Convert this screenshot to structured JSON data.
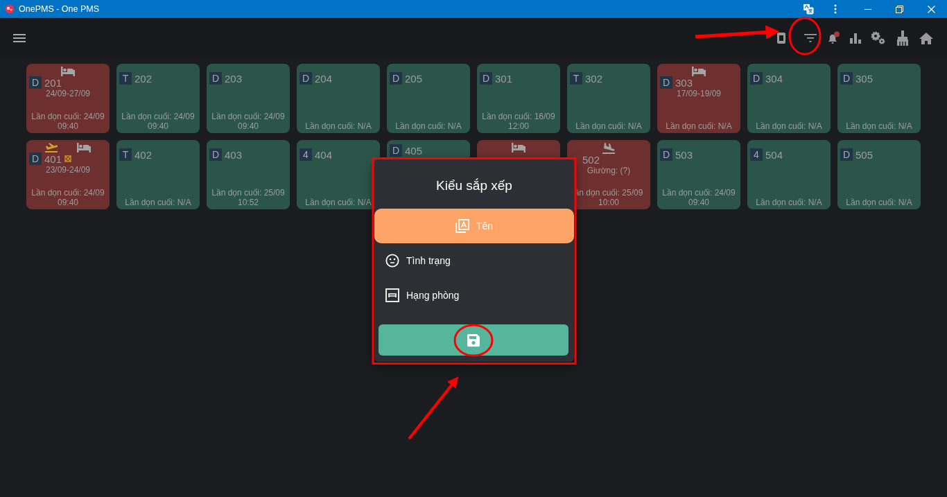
{
  "window": {
    "title": "OnePMS - One PMS"
  },
  "rooms": [
    {
      "badge": "D",
      "number": "201",
      "occupied": true,
      "bed": true,
      "departure": false,
      "arrival": false,
      "flagged": false,
      "dates": "24/09-27/09",
      "cleaning": [
        "Lần dọn cuối: 24/09",
        "09:40"
      ]
    },
    {
      "badge": "T",
      "number": "202",
      "occupied": false,
      "bed": false,
      "departure": false,
      "arrival": false,
      "flagged": false,
      "cleaning": [
        "Lần dọn cuối: 24/09",
        "09:40"
      ]
    },
    {
      "badge": "D",
      "number": "203",
      "occupied": false,
      "bed": false,
      "departure": false,
      "arrival": false,
      "flagged": false,
      "cleaning": [
        "Lần dọn cuối: 24/09",
        "09:40"
      ]
    },
    {
      "badge": "D",
      "number": "204",
      "occupied": false,
      "bed": false,
      "departure": false,
      "arrival": false,
      "flagged": false,
      "cleaning": [
        "Lần dọn cuối: N/A"
      ]
    },
    {
      "badge": "D",
      "number": "205",
      "occupied": false,
      "bed": false,
      "departure": false,
      "arrival": false,
      "flagged": false,
      "cleaning": [
        "Lần dọn cuối: N/A"
      ]
    },
    {
      "badge": "D",
      "number": "301",
      "occupied": false,
      "bed": false,
      "departure": false,
      "arrival": false,
      "flagged": false,
      "cleaning": [
        "Lần dọn cuối: 16/09",
        "12:00"
      ]
    },
    {
      "badge": "T",
      "number": "302",
      "occupied": false,
      "bed": false,
      "departure": false,
      "arrival": false,
      "flagged": false,
      "cleaning": [
        "Lần dọn cuối: N/A"
      ]
    },
    {
      "badge": "D",
      "number": "303",
      "occupied": true,
      "bed": true,
      "departure": false,
      "arrival": false,
      "flagged": false,
      "dates": "17/09-19/09",
      "cleaning": [
        "Lần dọn cuối: N/A"
      ]
    },
    {
      "badge": "D",
      "number": "304",
      "occupied": false,
      "bed": false,
      "departure": false,
      "arrival": false,
      "flagged": false,
      "cleaning": [
        "Lần dọn cuối: N/A"
      ]
    },
    {
      "badge": "D",
      "number": "305",
      "occupied": false,
      "bed": false,
      "departure": false,
      "arrival": false,
      "flagged": false,
      "cleaning": [
        "Lần dọn cuối: N/A"
      ]
    },
    {
      "badge": "D",
      "number": "401",
      "occupied": true,
      "bed": true,
      "departure": true,
      "arrival": false,
      "flagged": true,
      "dates": "23/09-24/09",
      "cleaning": [
        "Lần dọn cuối: 24/09",
        "09:40"
      ]
    },
    {
      "badge": "T",
      "number": "402",
      "occupied": false,
      "bed": false,
      "departure": false,
      "arrival": false,
      "flagged": false,
      "cleaning": [
        "Lần dọn cuối: N/A"
      ]
    },
    {
      "badge": "D",
      "number": "403",
      "occupied": false,
      "bed": false,
      "departure": false,
      "arrival": false,
      "flagged": false,
      "cleaning": [
        "Lần dọn cuối: 25/09",
        "10:52"
      ]
    },
    {
      "badge": "4",
      "number": "404",
      "occupied": false,
      "bed": false,
      "departure": false,
      "arrival": false,
      "flagged": false,
      "cleaning": [
        "Lần dọn cuối: N/A"
      ]
    },
    {
      "badge": "D",
      "number": "405",
      "occupied": false,
      "bed": false,
      "departure": false,
      "arrival": false,
      "flagged": false
    },
    {
      "occupied": true,
      "bed": true,
      "departure": false,
      "arrival": false,
      "flagged": false
    },
    {
      "number": "502",
      "occupied": true,
      "bed": false,
      "departure": false,
      "arrival": true,
      "flagged": false,
      "beds": "Giường:  (?)",
      "cleaning": [
        "ần dọn cuối: 25/09",
        "10:00"
      ]
    },
    {
      "badge": "D",
      "number": "503",
      "occupied": false,
      "bed": false,
      "departure": false,
      "arrival": false,
      "flagged": false,
      "cleaning": [
        "Lần dọn cuối: 24/09",
        "09:40"
      ]
    },
    {
      "badge": "4",
      "number": "504",
      "occupied": false,
      "bed": false,
      "departure": false,
      "arrival": false,
      "flagged": false,
      "cleaning": [
        "Lần dọn cuối: N/A"
      ]
    },
    {
      "badge": "D",
      "number": "505",
      "occupied": false,
      "bed": false,
      "departure": false,
      "arrival": false,
      "flagged": false,
      "cleaning": [
        "Lần dọn cuối: N/A"
      ]
    }
  ],
  "sort_dialog": {
    "title": "Kiểu sắp xếp",
    "options": [
      {
        "label": "Tên",
        "kind": "name",
        "selected": true
      },
      {
        "label": "Tình trạng",
        "kind": "status",
        "selected": false
      },
      {
        "label": "Hạng phòng",
        "kind": "room_type",
        "selected": false
      }
    ]
  }
}
